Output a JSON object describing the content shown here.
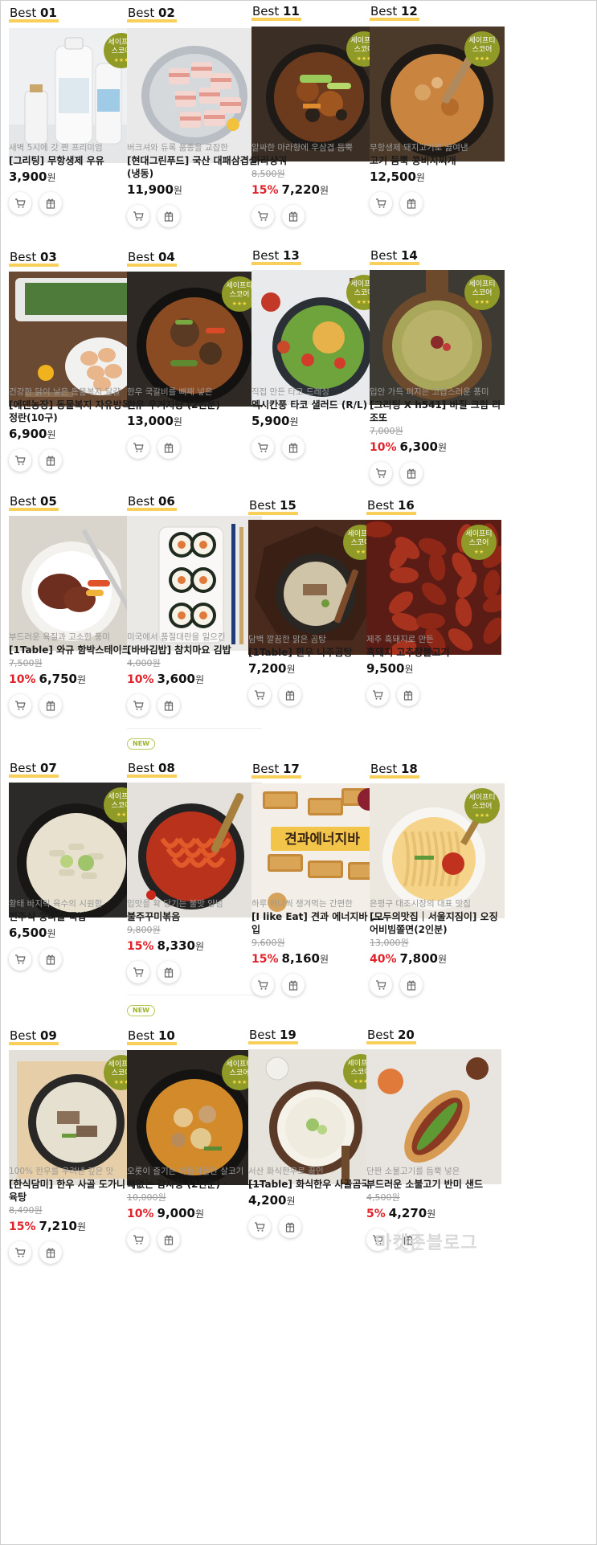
{
  "badge": {
    "line1": "세이프티",
    "line2": "스코어"
  },
  "currency": "원",
  "watermark": "마켓존블로그",
  "products": [
    {
      "prefix": "Best ",
      "rank": "01",
      "sub": "새벽 5시에 갓 짠 프리미엄",
      "title": "[그리팅] 무항생제 우유",
      "orig": "",
      "disc": "",
      "price": "3,900",
      "badge": true,
      "stars": "★★★",
      "new": false,
      "img": "milk"
    },
    {
      "prefix": "Best ",
      "rank": "02",
      "sub": "버크셔와 듀록 품종을 교잡한",
      "title": "[현대그린푸드] 국산 대패삼겹살 (냉동)",
      "orig": "",
      "disc": "",
      "price": "11,900",
      "badge": false,
      "stars": "",
      "new": false,
      "img": "pork"
    },
    {
      "prefix": "Best ",
      "rank": "11",
      "sub": "알싸한 마라향에 우삼겹 듬뿍",
      "title": "마라샹궈",
      "orig": "8,500원",
      "disc": "15%",
      "price": "7,220",
      "badge": true,
      "stars": "★★★",
      "new": false,
      "img": "mala"
    },
    {
      "prefix": "Best ",
      "rank": "12",
      "sub": "무항생제 돼지고기로 끓여낸",
      "title": "고기 듬뿍 콩비지찌개",
      "orig": "",
      "disc": "",
      "price": "12,500",
      "badge": true,
      "stars": "★★★",
      "new": false,
      "img": "stew"
    },
    {
      "prefix": "Best ",
      "rank": "03",
      "sub": "건강한 닭이 낳은 동물복지 달걀",
      "title": "[에덴농장] 동물복지 자유방목 유정란(10구)",
      "orig": "",
      "disc": "",
      "price": "6,900",
      "badge": false,
      "stars": "",
      "new": false,
      "img": "eggs"
    },
    {
      "prefix": "Best ",
      "rank": "04",
      "sub": "한우 국갈비를 뼈째 넣은",
      "title": "한우 우거지탕 (2인분)",
      "orig": "",
      "disc": "",
      "price": "13,000",
      "badge": true,
      "stars": "★★★",
      "new": false,
      "img": "soup"
    },
    {
      "prefix": "Best ",
      "rank": "13",
      "sub": "직접 만든 타코 드레싱",
      "title": "멕시칸풍 타코 샐러드 (R/L)",
      "orig": "",
      "disc": "",
      "price": "5,900",
      "badge": true,
      "stars": "★★★",
      "new": false,
      "img": "salad"
    },
    {
      "prefix": "Best ",
      "rank": "14",
      "sub": "입안 가득 퍼지는 고급스러운 풍미",
      "title": "[그리팅 X h541] 바질 크림 리조또",
      "orig": "7,000원",
      "disc": "10%",
      "price": "6,300",
      "badge": true,
      "stars": "★★★",
      "new": false,
      "img": "risotto"
    },
    {
      "prefix": "Best ",
      "rank": "05",
      "sub": "부드러운 육질과 고소한 풍미",
      "title": "[1Table] 와규 함박스테이크",
      "orig": "7,500원",
      "disc": "10%",
      "price": "6,750",
      "badge": false,
      "stars": "",
      "new": false,
      "img": "steak"
    },
    {
      "prefix": "Best ",
      "rank": "06",
      "sub": "미국에서 품절대란을 일으킨",
      "title": "[바바김밥] 참치마요 김밥",
      "orig": "4,000원",
      "disc": "10%",
      "price": "3,600",
      "badge": false,
      "stars": "",
      "new": true,
      "img": "kimbap"
    },
    {
      "prefix": "Best ",
      "rank": "15",
      "sub": "담백 깔끔한 맑은 곰탕",
      "title": "[1Table] 한우 나주곰탕",
      "orig": "",
      "disc": "",
      "price": "7,200",
      "badge": true,
      "stars": "★★",
      "new": false,
      "img": "gomtang"
    },
    {
      "prefix": "Best ",
      "rank": "16",
      "sub": "제주 흑돼지로 만든",
      "title": "흑돼지 고추장불고기",
      "orig": "",
      "disc": "",
      "price": "9,500",
      "badge": true,
      "stars": "★★",
      "new": false,
      "img": "bulgogi"
    },
    {
      "prefix": "Best ",
      "rank": "07",
      "sub": "황태 바지락 육수의 시원함",
      "title": "전주식 콩나물 국밥",
      "orig": "",
      "disc": "",
      "price": "6,500",
      "badge": true,
      "stars": "★★",
      "new": false,
      "img": "gukbap"
    },
    {
      "prefix": "Best ",
      "rank": "08",
      "sub": "입맛을 확 당기는 불맛 양념",
      "title": "불주꾸미볶음",
      "orig": "9,800원",
      "disc": "15%",
      "price": "8,330",
      "badge": false,
      "stars": "",
      "new": true,
      "img": "jjukumi"
    },
    {
      "prefix": "Best ",
      "rank": "17",
      "sub": "하루 하나씩 챙겨먹는 간편한",
      "title": "[I like Eat] 견과 에너지바 12입",
      "orig": "9,600원",
      "disc": "15%",
      "price": "8,160",
      "badge": false,
      "stars": "",
      "new": false,
      "img": "bars",
      "img_text": "견과에너지바"
    },
    {
      "prefix": "Best ",
      "rank": "18",
      "sub": "은평구 대조시장의 대표 맛집",
      "title": "[모두의맛집｜서울지짐이] 오징어비빔쫄면(2인분)",
      "orig": "13,000원",
      "disc": "40%",
      "price": "7,800",
      "badge": true,
      "stars": "★★★",
      "new": false,
      "img": "noodle"
    },
    {
      "prefix": "Best ",
      "rank": "09",
      "sub": "100% 한우를 우려낸 깊은 맛",
      "title": "[한식담미] 한우 사골 도가니 수육탕",
      "orig": "8,490원",
      "disc": "15%",
      "price": "7,210",
      "badge": true,
      "stars": "★★★",
      "new": false,
      "img": "dogani"
    },
    {
      "prefix": "Best ",
      "rank": "10",
      "sub": "오롯이 즐기는 야들야들한 살코기",
      "title": "뼈없는 감자탕 (2인분)",
      "orig": "10,000원",
      "disc": "10%",
      "price": "9,000",
      "badge": true,
      "stars": "★★★",
      "new": false,
      "img": "gamjatang"
    },
    {
      "prefix": "Best ",
      "rank": "19",
      "sub": "서산 화식한우로 끓인",
      "title": "[1Table] 화식한우 사골곰국",
      "orig": "",
      "disc": "",
      "price": "4,200",
      "badge": true,
      "stars": "★★★",
      "new": false,
      "img": "sagol"
    },
    {
      "prefix": "Best ",
      "rank": "20",
      "sub": "단짠 소불고기를 듬뿍 넣은",
      "title": "부드러운 소불고기 반미 샌드",
      "orig": "4,500원",
      "disc": "5%",
      "price": "4,270",
      "badge": false,
      "stars": "",
      "new": false,
      "img": "banhmi"
    }
  ]
}
